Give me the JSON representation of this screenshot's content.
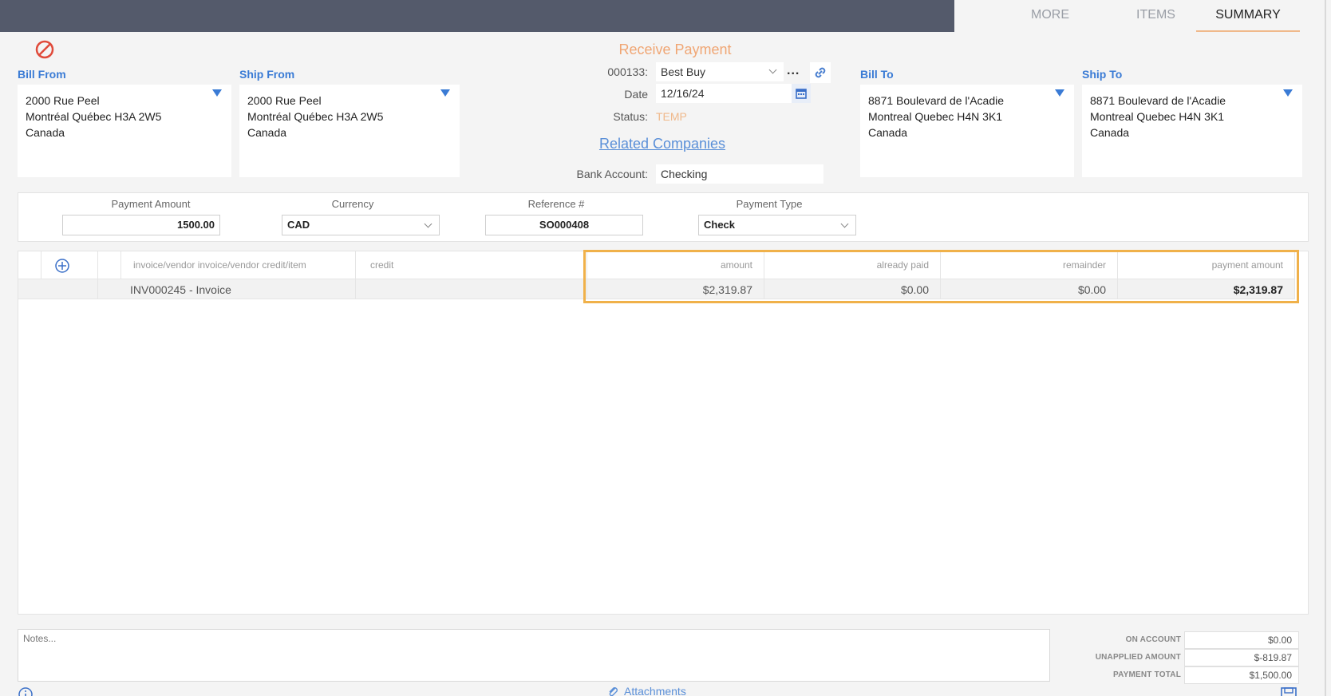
{
  "tabs": [
    {
      "label": "MORE"
    },
    {
      "label": "ITEMS"
    },
    {
      "label": "SUMMARY"
    }
  ],
  "title": "Receive Payment",
  "bill_from": {
    "label": "Bill From",
    "lines": [
      "2000 Rue Peel",
      "Montréal Québec H3A 2W5",
      "Canada"
    ]
  },
  "ship_from": {
    "label": "Ship From",
    "lines": [
      "2000 Rue Peel",
      "Montréal Québec H3A 2W5",
      "Canada"
    ]
  },
  "bill_to": {
    "label": "Bill To",
    "lines": [
      "8871 Boulevard de l'Acadie",
      "Montreal Quebec H4N 3K1",
      "Canada"
    ]
  },
  "ship_to": {
    "label": "Ship To",
    "lines": [
      "8871 Boulevard de l'Acadie",
      "Montreal Quebec H4N 3K1",
      "Canada"
    ]
  },
  "customer": {
    "label": "000133:",
    "value": "Best Buy",
    "more": "..."
  },
  "date": {
    "label": "Date",
    "value": "12/16/24"
  },
  "status": {
    "label": "Status:",
    "value": "TEMP"
  },
  "related_companies": "Related Companies",
  "bank_account": {
    "label": "Bank Account:",
    "value": "Checking"
  },
  "payment": {
    "amount_label": "Payment Amount",
    "amount_value": "1500.00",
    "currency_label": "Currency",
    "currency_value": "CAD",
    "reference_label": "Reference #",
    "reference_value": "SO000408",
    "type_label": "Payment Type",
    "type_value": "Check"
  },
  "grid": {
    "headers": [
      "invoice/vendor invoice/vendor credit/item",
      "credit",
      "amount",
      "already paid",
      "remainder",
      "payment amount"
    ],
    "rows": [
      {
        "item": "INV000245 - Invoice",
        "credit": "",
        "amount": "$2,319.87",
        "already_paid": "$0.00",
        "remainder": "$0.00",
        "payment_amount": "$2,319.87"
      }
    ]
  },
  "notes_placeholder": "Notes...",
  "totals": {
    "on_account_label": "ON ACCOUNT",
    "on_account_value": "$0.00",
    "unapplied_label": "UNAPPLIED AMOUNT",
    "unapplied_value": "$-819.87",
    "payment_total_label": "PAYMENT TOTAL",
    "payment_total_value": "$1,500.00"
  },
  "attachments": "Attachments",
  "colors": {
    "accent": "#f0a674",
    "link": "#5a8fd8",
    "highlight": "#f0b14a",
    "topbar": "#545a6b"
  }
}
